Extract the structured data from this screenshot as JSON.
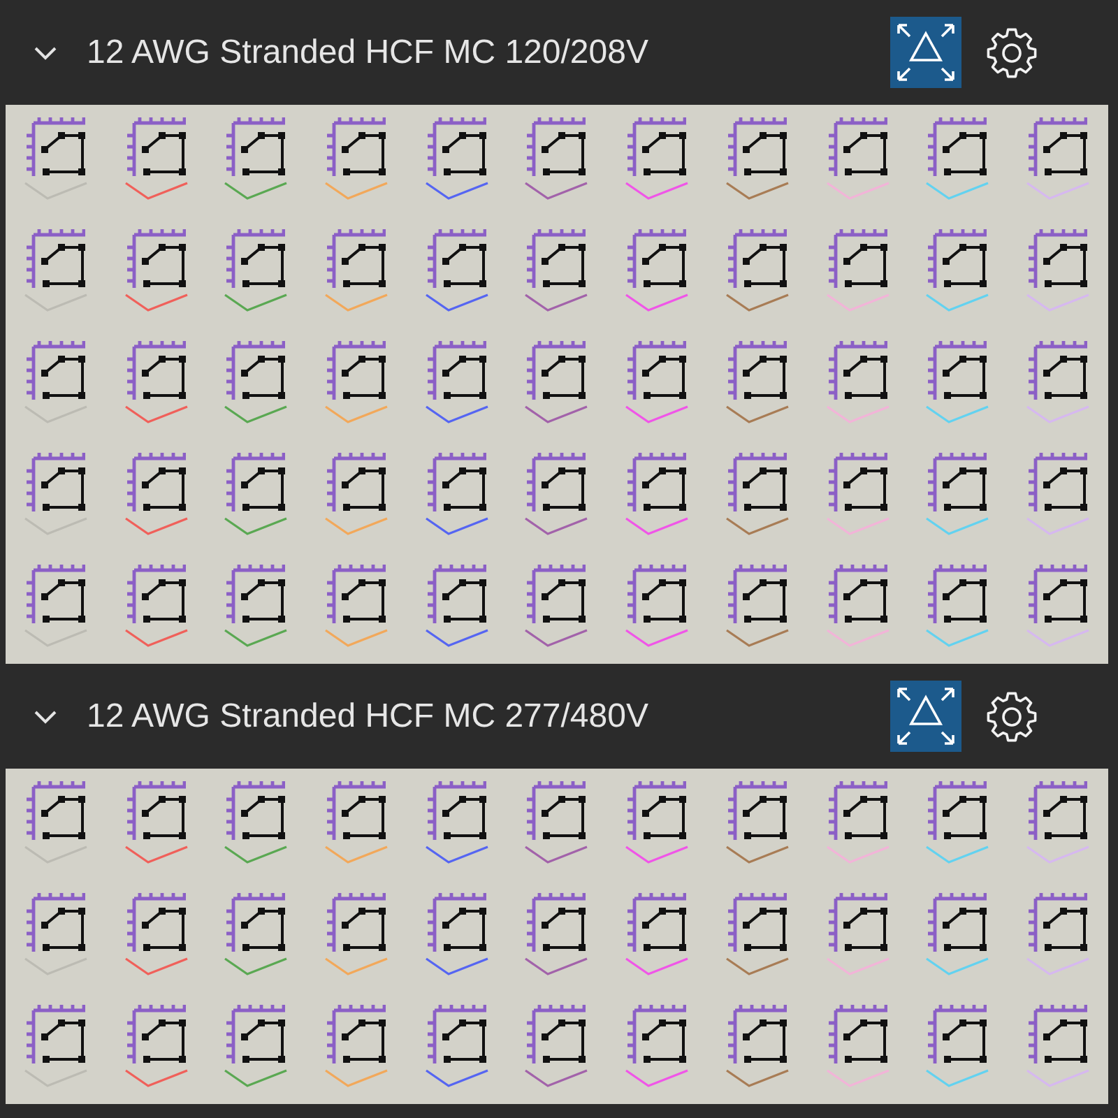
{
  "sections": [
    {
      "title": "12 AWG Stranded HCF MC 120/208V",
      "expanded": true,
      "items": [
        {
          "color": "#bcbbb3"
        },
        {
          "color": "#f0605a"
        },
        {
          "color": "#5aa852"
        },
        {
          "color": "#f2a85a"
        },
        {
          "color": "#5565f2"
        },
        {
          "color": "#a262aa"
        },
        {
          "color": "#f055e8"
        },
        {
          "color": "#a87c55"
        },
        {
          "color": "#f2b4d8"
        },
        {
          "color": "#62d2f0"
        },
        {
          "color": "#d6b8f0"
        },
        {
          "color": "#bcbbb3"
        },
        {
          "color": "#f0605a"
        },
        {
          "color": "#5aa852"
        },
        {
          "color": "#f2a85a"
        },
        {
          "color": "#5565f2"
        },
        {
          "color": "#a262aa"
        },
        {
          "color": "#f055e8"
        },
        {
          "color": "#a87c55"
        },
        {
          "color": "#f2b4d8"
        },
        {
          "color": "#62d2f0"
        },
        {
          "color": "#d6b8f0"
        },
        {
          "color": "#bcbbb3"
        },
        {
          "color": "#f0605a"
        },
        {
          "color": "#5aa852"
        },
        {
          "color": "#f2a85a"
        },
        {
          "color": "#5565f2"
        },
        {
          "color": "#a262aa"
        },
        {
          "color": "#f055e8"
        },
        {
          "color": "#a87c55"
        },
        {
          "color": "#f2b4d8"
        },
        {
          "color": "#62d2f0"
        },
        {
          "color": "#d6b8f0"
        },
        {
          "color": "#bcbbb3"
        },
        {
          "color": "#f0605a"
        },
        {
          "color": "#5aa852"
        },
        {
          "color": "#f2a85a"
        },
        {
          "color": "#5565f2"
        },
        {
          "color": "#a262aa"
        },
        {
          "color": "#f055e8"
        },
        {
          "color": "#a87c55"
        },
        {
          "color": "#f2b4d8"
        },
        {
          "color": "#62d2f0"
        },
        {
          "color": "#d6b8f0"
        },
        {
          "color": "#bcbbb3"
        },
        {
          "color": "#f0605a"
        },
        {
          "color": "#5aa852"
        },
        {
          "color": "#f2a85a"
        },
        {
          "color": "#5565f2"
        },
        {
          "color": "#a262aa"
        },
        {
          "color": "#f055e8"
        },
        {
          "color": "#a87c55"
        },
        {
          "color": "#f2b4d8"
        },
        {
          "color": "#62d2f0"
        },
        {
          "color": "#d6b8f0"
        }
      ]
    },
    {
      "title": "12 AWG Stranded HCF MC 277/480V",
      "expanded": true,
      "items": [
        {
          "color": "#bcbbb3"
        },
        {
          "color": "#f0605a"
        },
        {
          "color": "#5aa852"
        },
        {
          "color": "#f2a85a"
        },
        {
          "color": "#5565f2"
        },
        {
          "color": "#a262aa"
        },
        {
          "color": "#f055e8"
        },
        {
          "color": "#a87c55"
        },
        {
          "color": "#f2b4d8"
        },
        {
          "color": "#62d2f0"
        },
        {
          "color": "#d6b8f0"
        },
        {
          "color": "#bcbbb3"
        },
        {
          "color": "#f0605a"
        },
        {
          "color": "#5aa852"
        },
        {
          "color": "#f2a85a"
        },
        {
          "color": "#5565f2"
        },
        {
          "color": "#a262aa"
        },
        {
          "color": "#f055e8"
        },
        {
          "color": "#a87c55"
        },
        {
          "color": "#f2b4d8"
        },
        {
          "color": "#62d2f0"
        },
        {
          "color": "#d6b8f0"
        },
        {
          "color": "#bcbbb3"
        },
        {
          "color": "#f0605a"
        },
        {
          "color": "#5aa852"
        },
        {
          "color": "#f2a85a"
        },
        {
          "color": "#5565f2"
        },
        {
          "color": "#a262aa"
        },
        {
          "color": "#f055e8"
        },
        {
          "color": "#a87c55"
        },
        {
          "color": "#f2b4d8"
        },
        {
          "color": "#62d2f0"
        },
        {
          "color": "#d6b8f0"
        }
      ]
    }
  ]
}
